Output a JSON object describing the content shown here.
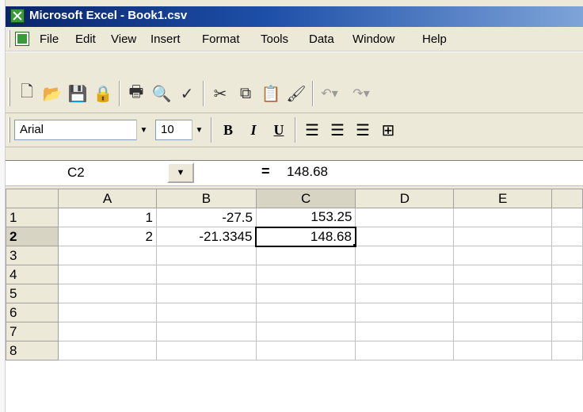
{
  "window": {
    "title": "Microsoft Excel - Book1.csv"
  },
  "menu": {
    "items": [
      "File",
      "Edit",
      "View",
      "Insert",
      "Format",
      "Tools",
      "Data",
      "Window",
      "Help"
    ]
  },
  "toolbar": {
    "icons": [
      "new-icon",
      "open-icon",
      "save-icon",
      "permission-icon",
      "print-icon",
      "print-preview-icon",
      "spelling-icon",
      "cut-icon",
      "copy-icon",
      "paste-icon",
      "format-painter-icon",
      "undo-icon",
      "redo-icon"
    ]
  },
  "format": {
    "font": "Arial",
    "size": "10",
    "bold": "B",
    "italic": "I",
    "underline": "U"
  },
  "formula_bar": {
    "name_box": "C2",
    "equals": "=",
    "formula": "148.68"
  },
  "grid": {
    "columns": [
      "A",
      "B",
      "C",
      "D",
      "E"
    ],
    "rows": [
      {
        "header": "1",
        "cells": [
          "1",
          "-27.5",
          "153.25",
          "",
          ""
        ]
      },
      {
        "header": "2",
        "cells": [
          "2",
          "-21.3345",
          "148.68",
          "",
          ""
        ]
      },
      {
        "header": "3",
        "cells": [
          "",
          "",
          "",
          "",
          ""
        ]
      },
      {
        "header": "4",
        "cells": [
          "",
          "",
          "",
          "",
          ""
        ]
      },
      {
        "header": "5",
        "cells": [
          "",
          "",
          "",
          "",
          ""
        ]
      },
      {
        "header": "6",
        "cells": [
          "",
          "",
          "",
          "",
          ""
        ]
      },
      {
        "header": "7",
        "cells": [
          "",
          "",
          "",
          "",
          ""
        ]
      },
      {
        "header": "8",
        "cells": [
          "",
          "",
          "",
          "",
          ""
        ]
      }
    ],
    "active_cell": "C2"
  }
}
